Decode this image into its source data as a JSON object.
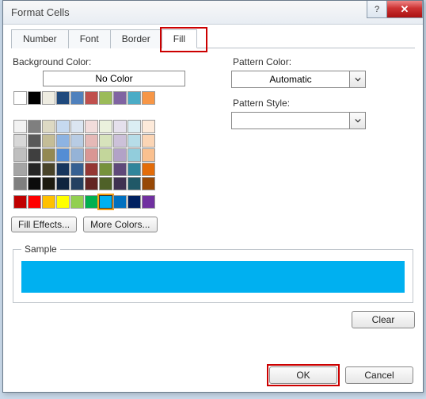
{
  "window": {
    "title": "Format Cells"
  },
  "tabs": {
    "number": "Number",
    "font": "Font",
    "border": "Border",
    "fill": "Fill",
    "active": "fill"
  },
  "labels": {
    "background_color": "Background Color:",
    "no_color": "No Color",
    "fill_effects": "Fill Effects...",
    "more_colors": "More Colors...",
    "pattern_color": "Pattern Color:",
    "pattern_style": "Pattern Style:",
    "automatic": "Automatic",
    "sample": "Sample",
    "clear": "Clear",
    "ok": "OK",
    "cancel": "Cancel"
  },
  "theme_colors": [
    [
      "#ffffff",
      "#000000",
      "#eeece1",
      "#1f497d",
      "#4f81bd",
      "#c0504d",
      "#9bbb59",
      "#8064a2",
      "#4bacc6",
      "#f79646"
    ],
    [
      "#f2f2f2",
      "#7f7f7f",
      "#ddd9c3",
      "#c6d9f0",
      "#dbe5f1",
      "#f2dcdb",
      "#ebf1dd",
      "#e5e0ec",
      "#dbeef3",
      "#fdeada"
    ],
    [
      "#d8d8d8",
      "#595959",
      "#c4bd97",
      "#8db3e2",
      "#b8cce4",
      "#e5b9b7",
      "#d7e3bc",
      "#ccc1d9",
      "#b7dde8",
      "#fbd5b5"
    ],
    [
      "#bfbfbf",
      "#3f3f3f",
      "#938953",
      "#548dd4",
      "#95b3d7",
      "#d99694",
      "#c3d69b",
      "#b2a2c7",
      "#92cddc",
      "#fac08f"
    ],
    [
      "#a5a5a5",
      "#262626",
      "#494429",
      "#17365d",
      "#366092",
      "#953734",
      "#76923c",
      "#5f497a",
      "#31859b",
      "#e36c09"
    ],
    [
      "#7f7f7f",
      "#0c0c0c",
      "#1d1b10",
      "#0f243e",
      "#244061",
      "#632423",
      "#4f6128",
      "#3f3151",
      "#205867",
      "#974806"
    ]
  ],
  "standard_colors": [
    "#c00000",
    "#ff0000",
    "#ffc000",
    "#ffff00",
    "#92d050",
    "#00b050",
    "#00b0f0",
    "#0070c0",
    "#002060",
    "#7030a0"
  ],
  "selected_standard_index": 6,
  "sample_color": "#00b0f0"
}
